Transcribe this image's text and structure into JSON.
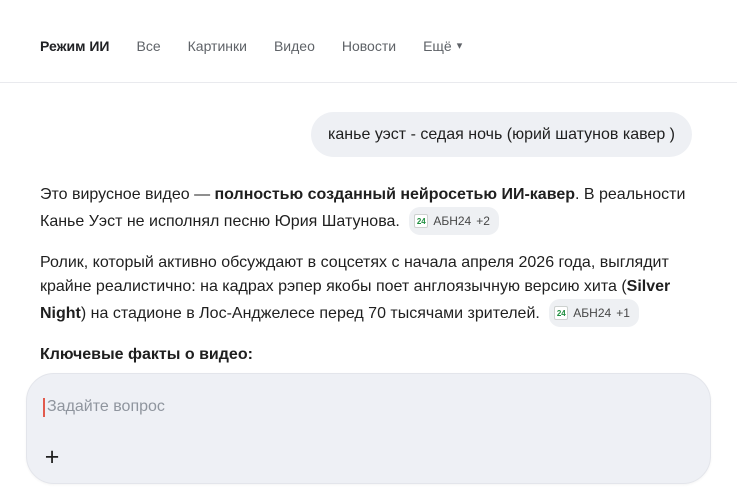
{
  "nav": {
    "tabs": [
      {
        "label": "Режим ИИ",
        "active": true
      },
      {
        "label": "Все",
        "active": false
      },
      {
        "label": "Картинки",
        "active": false
      },
      {
        "label": "Видео",
        "active": false
      },
      {
        "label": "Новости",
        "active": false
      },
      {
        "label": "Ещё",
        "active": false,
        "has_dropdown": true
      }
    ]
  },
  "query_bubble": {
    "text": "канье уэст - седая ночь (юрий шатунов кавер )"
  },
  "answer": {
    "paragraph1": {
      "part1": "Это вирусное видео — ",
      "bold1": "полностью созданный нейросетью ИИ-кавер",
      "part2": ". В реальности Канье Уэст не исполнял песню Юрия Шатунова.",
      "badge": {
        "source": "АБН24",
        "more": "+2"
      }
    },
    "paragraph2": {
      "part1": "Ролик, который активно обсуждают в соцсетях с начала апреля 2026 года, выглядит крайне реалистично: на кадрах рэпер якобы поет англоязычную версию хита (",
      "bold1": "Silver Night",
      "part2": ") на стадионе в Лос-Анджелесе перед 70 тысячами зрителей.",
      "badge": {
        "source": "АБН24",
        "more": "+1"
      }
    },
    "heading": "Ключевые факты о видео:"
  },
  "composer": {
    "placeholder": "Задайте вопрос"
  },
  "icons": {
    "dropdown_arrow": "▾",
    "plus": "+",
    "badge_favicon_text": "24"
  },
  "colors": {
    "accent_green": "#1e8e3e",
    "caret_red": "#e25a4d",
    "bubble_bg": "#eef0f4",
    "composer_bg": "#eef0f5",
    "nav_inactive": "#5f6368",
    "text": "#1f1f1f"
  }
}
